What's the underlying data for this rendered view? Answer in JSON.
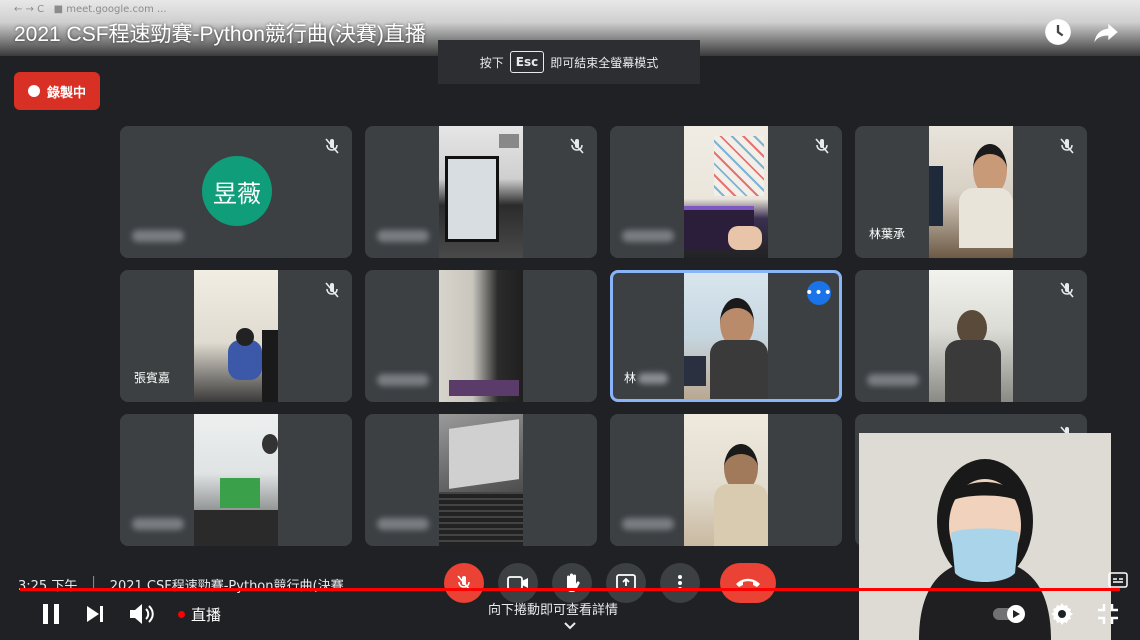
{
  "video": {
    "title": "2021 CSF程速勁賽-Python競行曲(決賽)直播"
  },
  "fullscreen_hint": {
    "prefix": "按下",
    "key": "Esc",
    "suffix": "即可結束全螢幕模式"
  },
  "recording_badge": {
    "label": "錄製中",
    "color": "#d93025"
  },
  "participants": [
    {
      "name": "",
      "avatar_initials": "昱薇",
      "has_video": false,
      "muted": true
    },
    {
      "name": "",
      "has_video": true,
      "muted": true
    },
    {
      "name": "",
      "has_video": true,
      "muted": true
    },
    {
      "name": "林葉承",
      "has_video": true,
      "muted": true
    },
    {
      "name": "張賓嘉",
      "has_video": true,
      "muted": true
    },
    {
      "name": "",
      "has_video": true,
      "muted": false
    },
    {
      "name": "林",
      "has_video": true,
      "muted": false,
      "active_speaker": true
    },
    {
      "name": "",
      "has_video": true,
      "muted": true
    },
    {
      "name": "",
      "has_video": true,
      "muted": false
    },
    {
      "name": "",
      "has_video": true,
      "muted": false
    },
    {
      "name": "",
      "has_video": true,
      "muted": false
    },
    {
      "name": "",
      "has_video": false,
      "muted": true
    }
  ],
  "meeting_bar": {
    "time": "3:25 下午",
    "meeting_title": "2021 CSF程速勁賽-Python競行曲(決賽..."
  },
  "player": {
    "live_label": "直播",
    "scroll_hint": "向下捲動即可查看詳情",
    "progress_color": "#ff0000"
  },
  "colors": {
    "tile_bg": "#3c4043",
    "active_border": "#8ab4f8",
    "avatar_bg": "#0f9d7a",
    "hangup": "#ea4335"
  }
}
